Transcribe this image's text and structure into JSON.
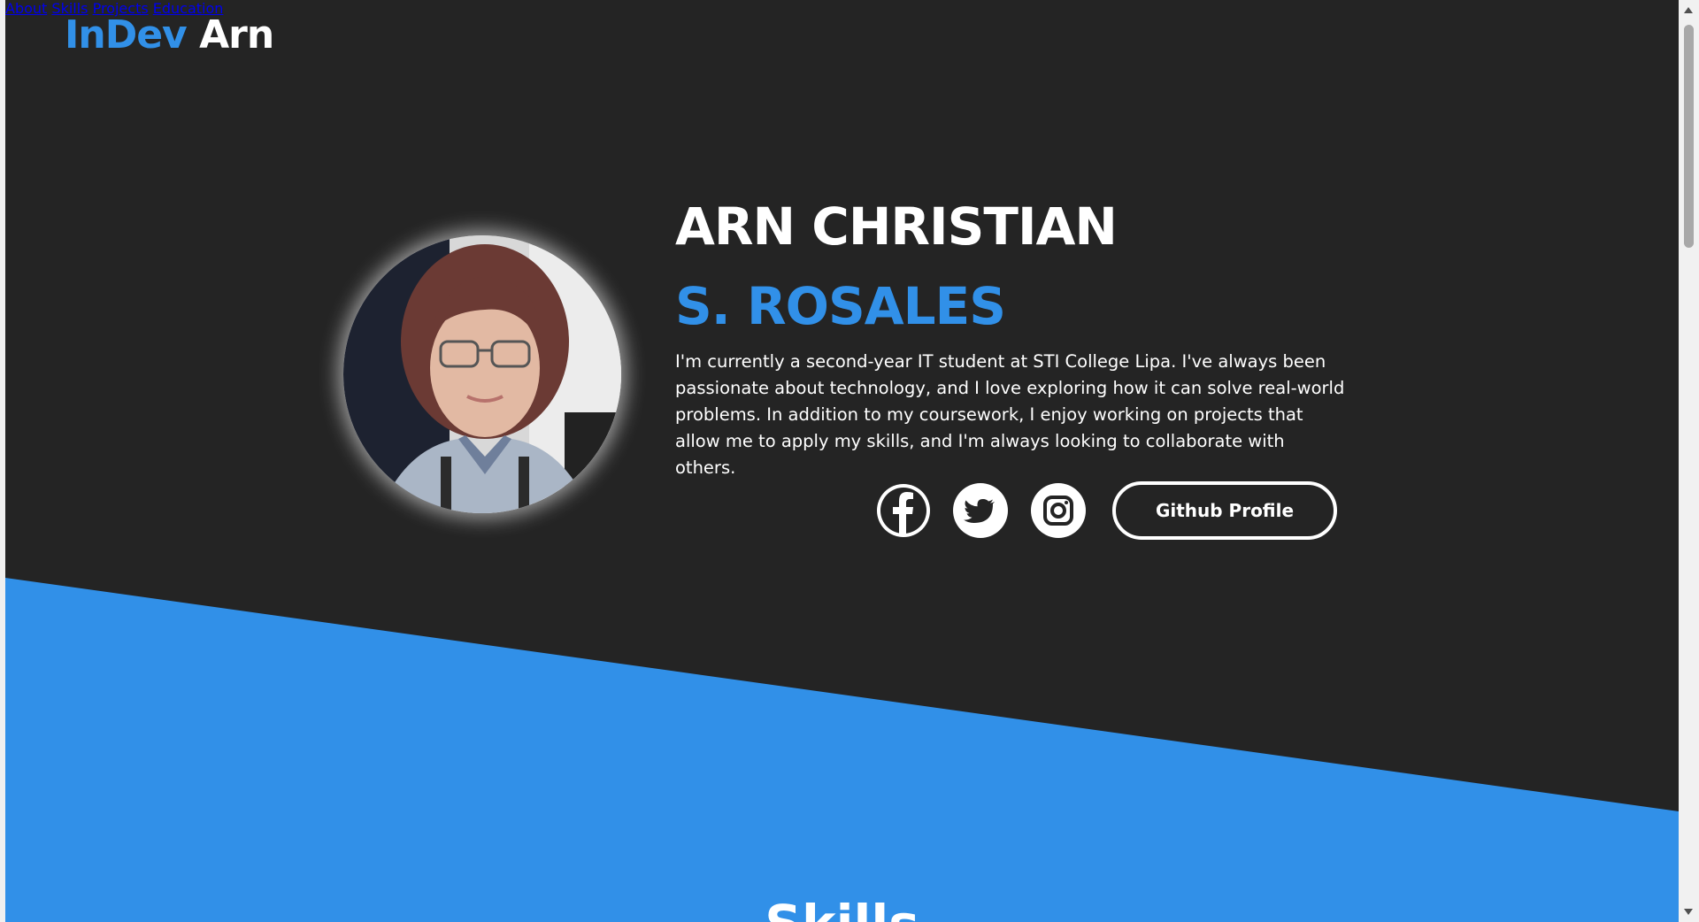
{
  "header": {
    "logo_accent": "InDev",
    "logo_rest": " Arn",
    "nav": [
      {
        "label": "About"
      },
      {
        "label": "Skills"
      },
      {
        "label": "Projects"
      },
      {
        "label": "Education"
      }
    ]
  },
  "hero": {
    "name_first": "ARN CHRISTIAN",
    "name_last": "S. ROSALES",
    "bio": "I'm currently a second-year IT student at STI College Lipa. I've always been passionate about technology, and I love exploring how it can solve real-world problems. In addition to my coursework, I enjoy working on projects that allow me to apply my skills, and I'm always looking to collaborate with others.",
    "socials": [
      {
        "icon": "facebook-icon"
      },
      {
        "icon": "twitter-icon"
      },
      {
        "icon": "instagram-icon"
      }
    ],
    "github_label": "Github Profile"
  },
  "skills_section": {
    "heading": "Skills"
  },
  "colors": {
    "background": "#242424",
    "accent": "#3190e8",
    "text": "#ffffff"
  }
}
